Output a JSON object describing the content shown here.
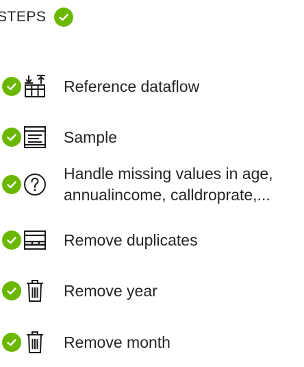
{
  "header": {
    "title": "STEPS"
  },
  "colors": {
    "success": "#6bb700",
    "text": "#252423"
  },
  "steps": [
    {
      "label": "Reference dataflow",
      "icon": "reference-dataflow-icon",
      "status": "success"
    },
    {
      "label": "Sample",
      "icon": "sample-icon",
      "status": "success"
    },
    {
      "label_line1": "Handle missing values in age,",
      "label_line2": "annualincome, calldroprate,...",
      "icon": "question-circle-icon",
      "status": "success"
    },
    {
      "label": "Remove duplicates",
      "icon": "remove-duplicates-icon",
      "status": "success"
    },
    {
      "label": "Remove year",
      "icon": "trash-icon",
      "status": "success"
    },
    {
      "label": "Remove month",
      "icon": "trash-icon",
      "status": "success"
    }
  ]
}
